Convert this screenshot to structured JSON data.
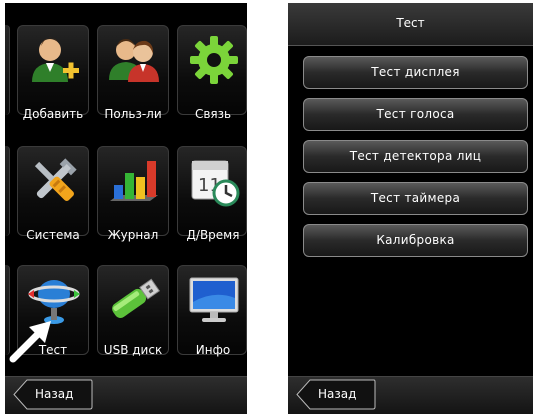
{
  "left_screen": {
    "tiles": [
      {
        "label": "Добавить",
        "icon": "add-user-icon"
      },
      {
        "label": "Польз-ли",
        "icon": "users-icon"
      },
      {
        "label": "Связь",
        "icon": "gear-icon"
      },
      {
        "label": "Система",
        "icon": "tools-icon"
      },
      {
        "label": "Журнал",
        "icon": "bar-chart-icon"
      },
      {
        "label": "Д/Время",
        "icon": "calendar-clock-icon"
      },
      {
        "label": "Тест",
        "icon": "test-icon"
      },
      {
        "label": "USB диск",
        "icon": "usb-drive-icon"
      },
      {
        "label": "Инфо",
        "icon": "monitor-icon"
      }
    ],
    "back_label": "Назад"
  },
  "right_screen": {
    "title": "Тест",
    "items": [
      {
        "label": "Тест дисплея"
      },
      {
        "label": "Тест голоса"
      },
      {
        "label": "Тест детектора лиц"
      },
      {
        "label": "Тест таймера"
      },
      {
        "label": "Калибровка"
      }
    ],
    "back_label": "Назад"
  },
  "colors": {
    "screen_bg": "#000000",
    "accent_green": "#7bd43a",
    "accent_blue": "#2a7fd6"
  }
}
